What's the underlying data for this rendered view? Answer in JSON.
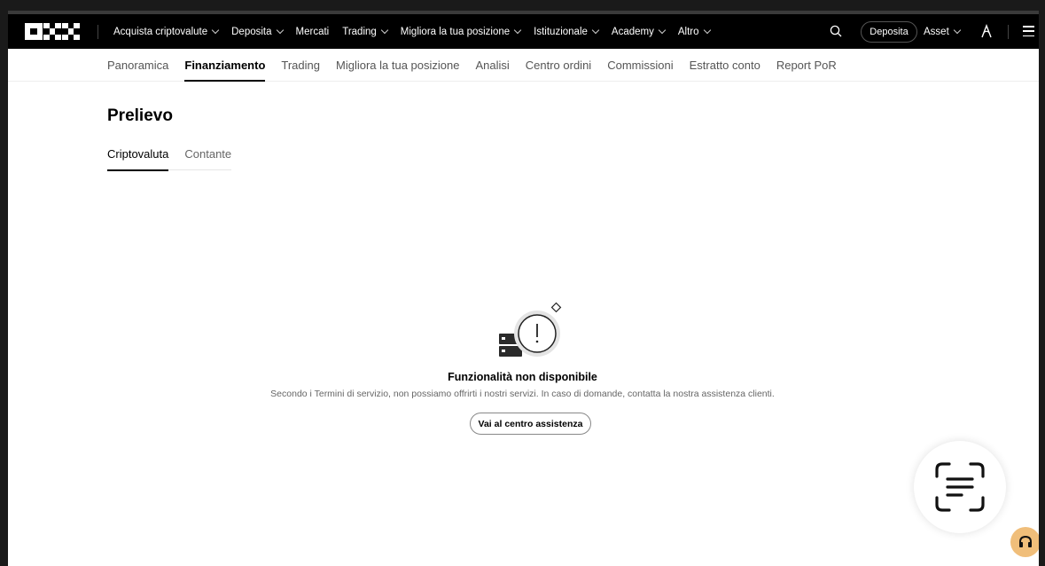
{
  "topnav": {
    "items": [
      {
        "label": "Acquista criptovalute",
        "has_chevron": true
      },
      {
        "label": "Deposita",
        "has_chevron": true
      },
      {
        "label": "Mercati",
        "has_chevron": false
      },
      {
        "label": "Trading",
        "has_chevron": true
      },
      {
        "label": "Migliora la tua posizione",
        "has_chevron": true
      },
      {
        "label": "Istituzionale",
        "has_chevron": true
      },
      {
        "label": "Academy",
        "has_chevron": true
      },
      {
        "label": "Altro",
        "has_chevron": true
      }
    ],
    "deposit_button": "Deposita",
    "asset_label": "Asset"
  },
  "subnav": {
    "items": [
      {
        "label": "Panoramica",
        "active": false
      },
      {
        "label": "Finanziamento",
        "active": true
      },
      {
        "label": "Trading",
        "active": false
      },
      {
        "label": "Migliora la tua posizione",
        "active": false
      },
      {
        "label": "Analisi",
        "active": false
      },
      {
        "label": "Centro ordini",
        "active": false
      },
      {
        "label": "Commissioni",
        "active": false
      },
      {
        "label": "Estratto conto",
        "active": false
      },
      {
        "label": "Report PoR",
        "active": false
      }
    ]
  },
  "page": {
    "title": "Prelievo",
    "tabs": [
      {
        "label": "Criptovaluta",
        "active": true
      },
      {
        "label": "Contante",
        "active": false
      }
    ]
  },
  "empty_state": {
    "title": "Funzionalità non disponibile",
    "description": "Secondo i Termini di servizio, non possiamo offrirti i nostri servizi. In caso di domande, contatta la nostra assistenza clienti.",
    "button": "Vai al centro assistenza"
  },
  "colors": {
    "topnav_bg": "#000000",
    "accent": "#000000",
    "support_fab": "#f0be7a"
  }
}
